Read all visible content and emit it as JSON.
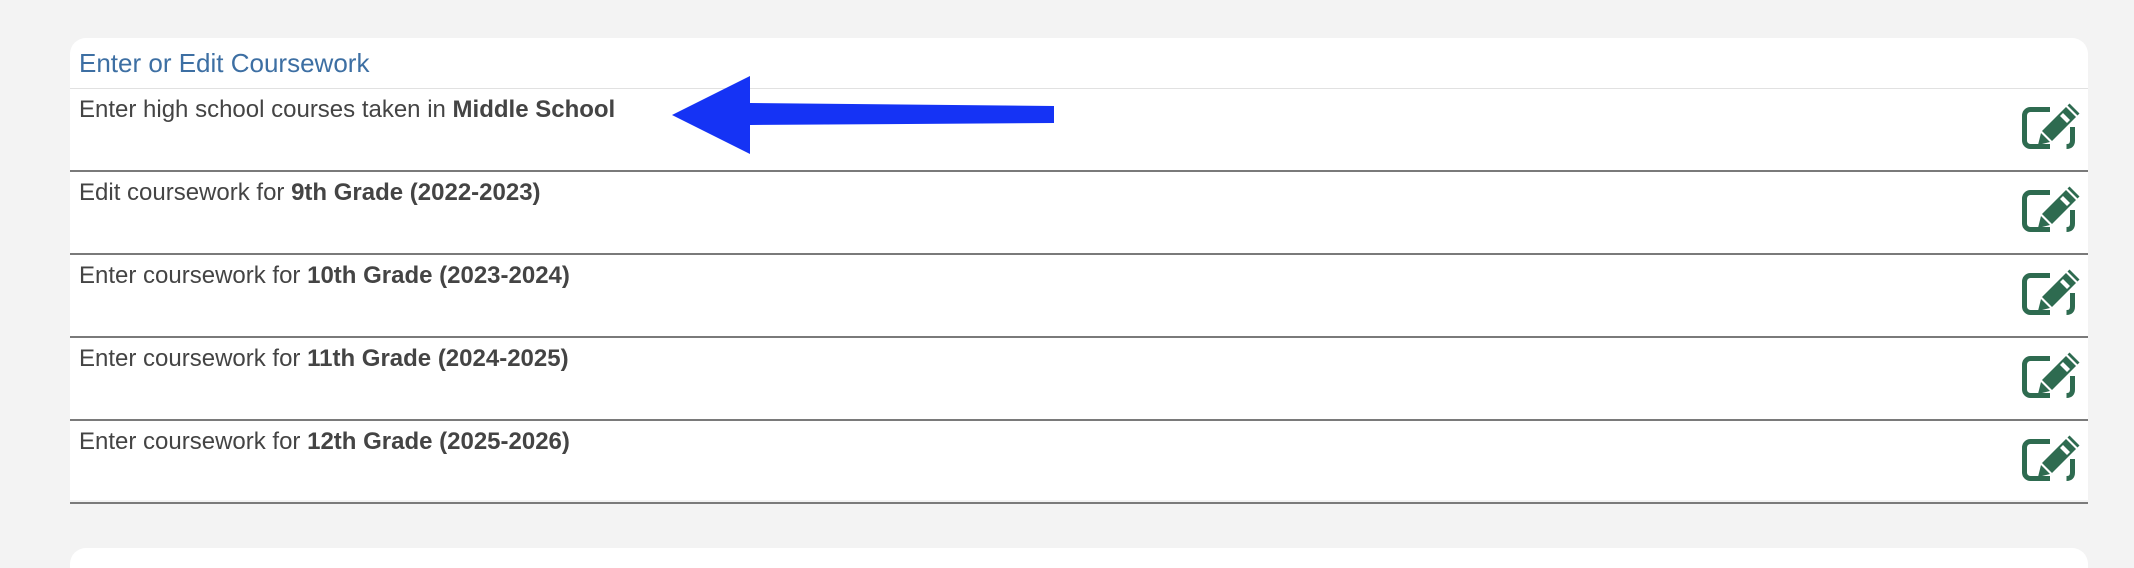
{
  "panel": {
    "title": "Enter or Edit Coursework"
  },
  "rows": [
    {
      "prefix": "Enter high school courses taken in ",
      "emphasis": "Middle School",
      "icon": "edit-icon"
    },
    {
      "prefix": "Edit coursework for ",
      "emphasis": "9th Grade (2022-2023)",
      "icon": "edit-icon"
    },
    {
      "prefix": "Enter coursework for ",
      "emphasis": "10th Grade (2023-2024)",
      "icon": "edit-icon"
    },
    {
      "prefix": "Enter coursework for ",
      "emphasis": "11th Grade (2024-2025)",
      "icon": "edit-icon"
    },
    {
      "prefix": "Enter coursework for ",
      "emphasis": "12th Grade (2025-2026)",
      "icon": "edit-icon"
    }
  ],
  "colors": {
    "title": "#3d6fa3",
    "row_text": "#444444",
    "edit_icon": "#2e6b50",
    "annotation_arrow": "#1533f5",
    "row_divider": "#7a7a7a",
    "page_background": "#f3f3f3"
  },
  "annotation": {
    "type": "arrow",
    "direction": "left",
    "icon": "left-arrow-annotation"
  }
}
